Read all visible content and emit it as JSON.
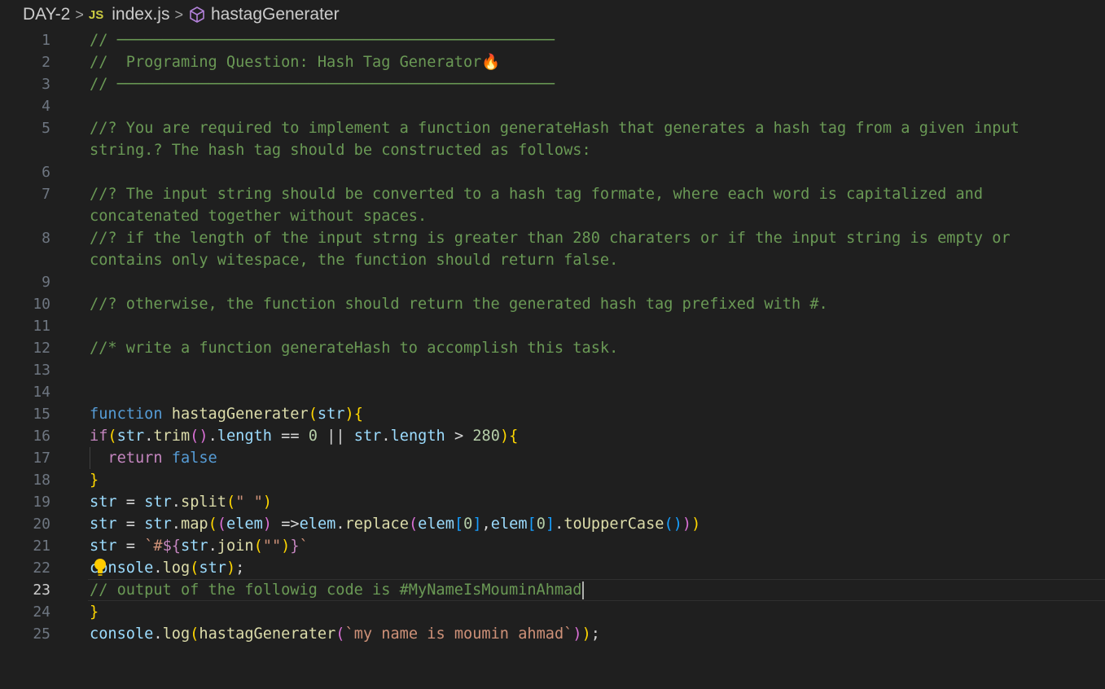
{
  "breadcrumb": {
    "folder": "DAY-2",
    "separator": ">",
    "file_icon": "JS",
    "file": "index.js",
    "symbol": "hastagGenerater"
  },
  "editor": {
    "active_line": 23,
    "lines": [
      {
        "n": "1",
        "text": "// ────────────────────────────────────────────────"
      },
      {
        "n": "2",
        "text": "//  Programing Question: Hash Tag Generator🔥"
      },
      {
        "n": "3",
        "text": "// ────────────────────────────────────────────────"
      },
      {
        "n": "4",
        "text": ""
      },
      {
        "n": "5",
        "text": "//? You are required to implement a function generateHash that generates a hash tag from a given input",
        "wrap": "string.? The hash tag should be constructed as follows:"
      },
      {
        "n": "6",
        "text": ""
      },
      {
        "n": "7",
        "text": "//? The input string should be converted to a hash tag formate, where each word is capitalized and",
        "wrap": "concatenated together without spaces."
      },
      {
        "n": "8",
        "text": "//? if the length of the input strng is greater than 280 charaters or if the input string is empty or",
        "wrap": "contains only witespace, the function should return false."
      },
      {
        "n": "9",
        "text": ""
      },
      {
        "n": "10",
        "text": "//? otherwise, the function should return the generated hash tag prefixed with #."
      },
      {
        "n": "11",
        "text": ""
      },
      {
        "n": "12",
        "text": "//* write a function generateHash to accomplish this task."
      },
      {
        "n": "13",
        "text": ""
      },
      {
        "n": "14",
        "text": ""
      },
      {
        "n": "15",
        "text": "function hastagGenerater(str){"
      },
      {
        "n": "16",
        "text": "if(str.trim().length == 0 || str.length > 280){"
      },
      {
        "n": "17",
        "text": "  return false"
      },
      {
        "n": "18",
        "text": "}"
      },
      {
        "n": "19",
        "text": "str = str.split(\" \")"
      },
      {
        "n": "20",
        "text": "str = str.map((elem) =>elem.replace(elem[0],elem[0].toUpperCase()))"
      },
      {
        "n": "21",
        "text": "str = `#${str.join(\"\")}`"
      },
      {
        "n": "22",
        "text": "console.log(str);"
      },
      {
        "n": "23",
        "text": "// output of the followig code is #MyNameIsMouminAhmad"
      },
      {
        "n": "24",
        "text": "}"
      },
      {
        "n": "25",
        "text": "console.log(hastagGenerater(`my name is moumin ahmad`));"
      }
    ]
  },
  "colors": {
    "background": "#1f1f1f",
    "comment": "#6a9955",
    "keyword": "#569cd6",
    "function": "#dcdcaa",
    "variable": "#9cdcfe",
    "string": "#ce9178",
    "number": "#b5cea8"
  },
  "icons": [
    "js-file-icon",
    "cube-icon",
    "lightbulb-icon",
    "fire-emoji"
  ]
}
